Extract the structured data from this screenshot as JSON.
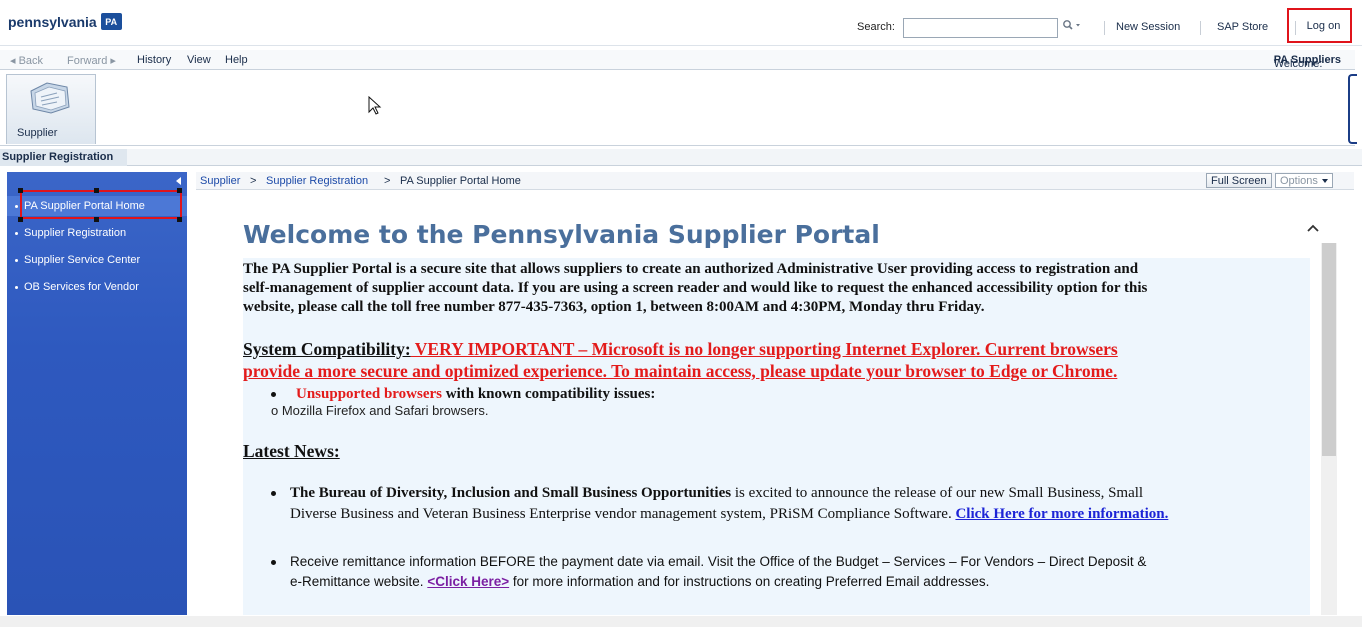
{
  "header": {
    "logo_text": "pennsylvania",
    "logo_badge": "PA",
    "search_label": "Search:",
    "search_value": "",
    "search_icon": "magnifier-dropdown-icon",
    "links": [
      "New Session",
      "SAP Store"
    ],
    "logon_label": "Log on"
  },
  "navline": {
    "back": "◂ Back",
    "forward": "Forward ▸",
    "history": "History",
    "view": "View",
    "help": "Help",
    "welcome_prefix": "Welcome: ",
    "welcome_user": "PA Suppliers"
  },
  "role": {
    "label": "Supplier",
    "icon": "supplier-folder-icon"
  },
  "subtab": {
    "label": "Supplier Registration"
  },
  "leftnav": {
    "items": [
      {
        "label": "PA Supplier Portal Home",
        "active": true
      },
      {
        "label": "Supplier Registration",
        "active": false
      },
      {
        "label": "Supplier Service Center",
        "active": false
      },
      {
        "label": "OB Services for Vendor",
        "active": false
      }
    ]
  },
  "breadcrumb": {
    "items": [
      "Supplier",
      "Supplier Registration",
      "PA Supplier Portal Home"
    ],
    "separator": ">"
  },
  "content_toolbar": {
    "full_screen": "Full Screen",
    "options": "Options"
  },
  "content": {
    "title": "Welcome to the Pennsylvania Supplier Portal",
    "intro_lines": [
      "The PA Supplier Portal is a secure site that allows suppliers to create an authorized Administrative User providing access to registration and",
      "self-management of supplier account data. If you are using a screen reader and would like to request the enhanced accessibility option for this",
      "website, please call the toll free number 877-435-7363, option 1, between 8:00AM and 4:30PM, Monday thru Friday."
    ],
    "compat_label": "System Compatibility:",
    "compat_line1": " VERY IMPORTANT – Microsoft is no longer supporting Internet Explorer.  Current browsers",
    "compat_line2": "provide a more secure and optimized experience.  To maintain access, please update your browser to Edge or Chrome.",
    "unsupported_red": "Unsupported browsers",
    "unsupported_rest": " with known compatibility issues:",
    "unsupported_sub": "o  Mozilla Firefox and Safari browsers.",
    "latest_news": "Latest News:",
    "news1_bold": "The Bureau of Diversity, Inclusion and Small Business Opportunities",
    "news1_rest": " is excited to announce the release of our new Small Business, Small",
    "news1_line2": "Diverse Business and Veteran Business Enterprise vendor management system, PRiSM Compliance Software. ",
    "news1_link": "Click Here for more information.",
    "news2_line1": "Receive remittance information BEFORE the payment date via email.  Visit the Office of the Budget – Services – For Vendors – Direct Deposit &",
    "news2_pre": "e-Remittance website.  ",
    "news2_link": "<Click Here>",
    "news2_post": " for more information and for instructions on creating Preferred Email addresses."
  },
  "colors": {
    "nav_blue": "#2e59bf",
    "title_blue": "#4a6f9c",
    "warning_red": "#e31b1b",
    "highlight_red": "#e0141b",
    "link_blue": "#1c24d6",
    "link_purple": "#7b1fa2"
  }
}
